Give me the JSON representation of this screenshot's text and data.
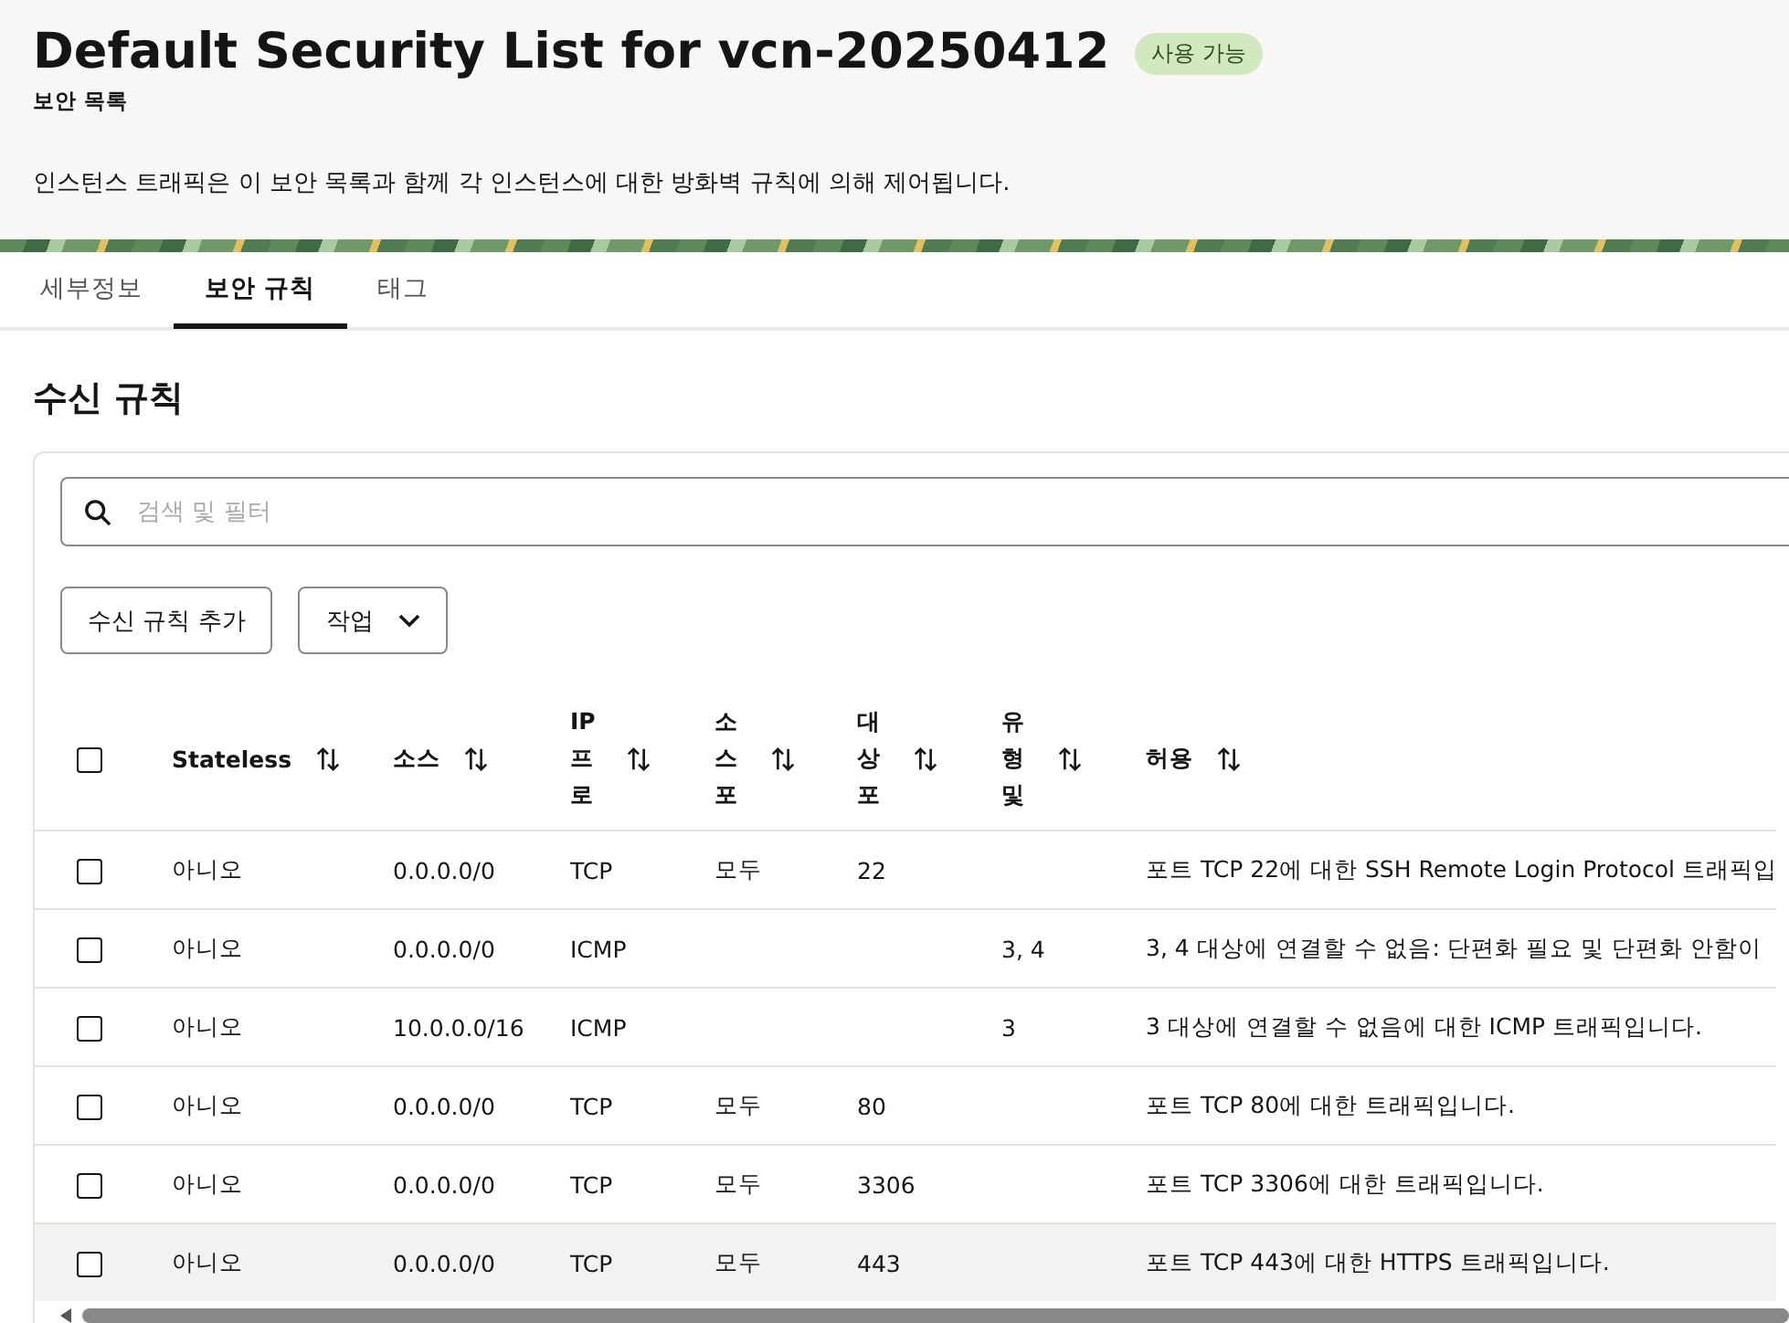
{
  "header": {
    "title": "Default Security List for vcn-20250412",
    "status": "사용 가능",
    "subtitle": "보안 목록",
    "description": "인스턴스 트래픽은 이 보안 목록과 함께 각 인스턴스에 대한 방화벽 규칙에 의해 제어됩니다."
  },
  "tabs": [
    {
      "label": "세부정보",
      "selected": false
    },
    {
      "label": "보안 규칙",
      "selected": true
    },
    {
      "label": "태그",
      "selected": false
    }
  ],
  "section_title": "수신 규칙",
  "search": {
    "placeholder": "검색 및 필터"
  },
  "buttons": [
    {
      "label": "수신 규칙 추가",
      "kind": "plain"
    },
    {
      "label": "작업",
      "kind": "menu"
    }
  ],
  "table": {
    "select_all": {
      "checked": false
    },
    "columns": [
      {
        "label": "Stateless",
        "narrow": false
      },
      {
        "label": "소스",
        "narrow": false
      },
      {
        "label": "IP 프로",
        "narrow": true
      },
      {
        "label": "소스 포",
        "narrow": true
      },
      {
        "label": "대상 포",
        "narrow": true
      },
      {
        "label": "유형 및",
        "narrow": true
      },
      {
        "label": "허용",
        "narrow": false
      }
    ],
    "rows": [
      {
        "checked": false,
        "highlighted": false,
        "cells": [
          "아니오",
          "0.0.0.0/0",
          "TCP",
          "모두",
          "22",
          "",
          "포트 TCP 22에 대한 SSH Remote Login Protocol 트래픽입"
        ]
      },
      {
        "checked": false,
        "highlighted": false,
        "cells": [
          "아니오",
          "0.0.0.0/0",
          "ICMP",
          "",
          "",
          "3, 4",
          "3, 4 대상에 연결할 수 없음: 단편화 필요 및 단편화 안함이"
        ]
      },
      {
        "checked": false,
        "highlighted": false,
        "cells": [
          "아니오",
          "10.0.0.0/16",
          "ICMP",
          "",
          "",
          "3",
          "3 대상에 연결할 수 없음에 대한 ICMP 트래픽입니다."
        ]
      },
      {
        "checked": false,
        "highlighted": false,
        "cells": [
          "아니오",
          "0.0.0.0/0",
          "TCP",
          "모두",
          "80",
          "",
          "포트 TCP 80에 대한 트래픽입니다."
        ]
      },
      {
        "checked": false,
        "highlighted": false,
        "cells": [
          "아니오",
          "0.0.0.0/0",
          "TCP",
          "모두",
          "3306",
          "",
          "포트 TCP 3306에 대한 트래픽입니다."
        ]
      },
      {
        "checked": false,
        "highlighted": true,
        "cells": [
          "아니오",
          "0.0.0.0/0",
          "TCP",
          "모두",
          "443",
          "",
          "포트 TCP 443에 대한 HTTPS 트래픽입니다."
        ]
      }
    ]
  }
}
